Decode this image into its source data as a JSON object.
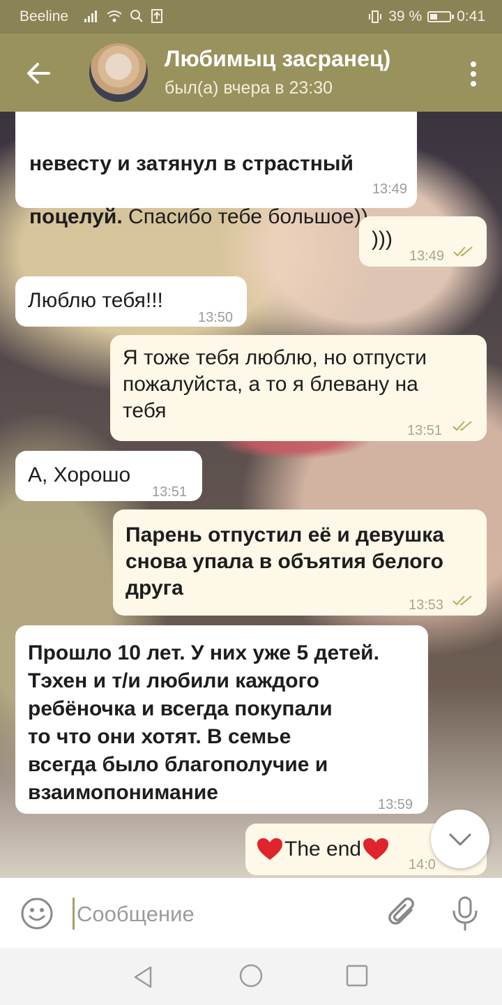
{
  "status_bar": {
    "carrier": "Beeline",
    "battery_text": "39 %",
    "battery_level": 0.39,
    "time": "0:41"
  },
  "header": {
    "title": "Любимыц засранец)",
    "subtitle": "был(а) вчера в 23:30"
  },
  "messages": [
    {
      "text": "невесту и затянул в страстный",
      "text2": "поцелуй.",
      "text3": " Спасибо тебе большое))",
      "time": "13:49",
      "direction": "incoming"
    },
    {
      "text": ")))",
      "time": "13:49",
      "direction": "outgoing"
    },
    {
      "text": "Люблю тебя!!!",
      "time": "13:50",
      "direction": "incoming"
    },
    {
      "text": "Я тоже тебя люблю, но отпусти\nпожалуйста, а то я блевану на\nтебя",
      "time": "13:51",
      "direction": "outgoing"
    },
    {
      "text": "А, Хорошо",
      "time": "13:51",
      "direction": "incoming"
    },
    {
      "text": "Парень отпустил её и девушка\nснова упала в объятия белого\nдруга",
      "time": "13:53",
      "direction": "outgoing"
    },
    {
      "text": "Прошло 10 лет. У них уже 5 детей.\nТэхен и т/и любили каждого\nребёночка и всегда покупали\nто что они хотят. В семье\nвсегда было благополучие и\nвзаимопонимание",
      "time": "13:59",
      "direction": "incoming"
    },
    {
      "text": "The end",
      "time": "14:0",
      "direction": "outgoing"
    }
  ],
  "input": {
    "placeholder": "Сообщение"
  },
  "colors": {
    "header": "#9a925d",
    "status_bar": "#8a8356",
    "outgoing_bubble": "#fdf8e7",
    "incoming_bubble": "#ffffff",
    "check": "#b8ad5a",
    "heart": "#e0242c"
  },
  "icons": [
    "back-arrow-icon",
    "more-vert-icon",
    "emoji-icon",
    "attach-icon",
    "mic-icon",
    "chevron-down-icon",
    "double-check-icon",
    "heart-icon",
    "nav-back-icon",
    "nav-home-icon",
    "nav-recent-icon"
  ]
}
